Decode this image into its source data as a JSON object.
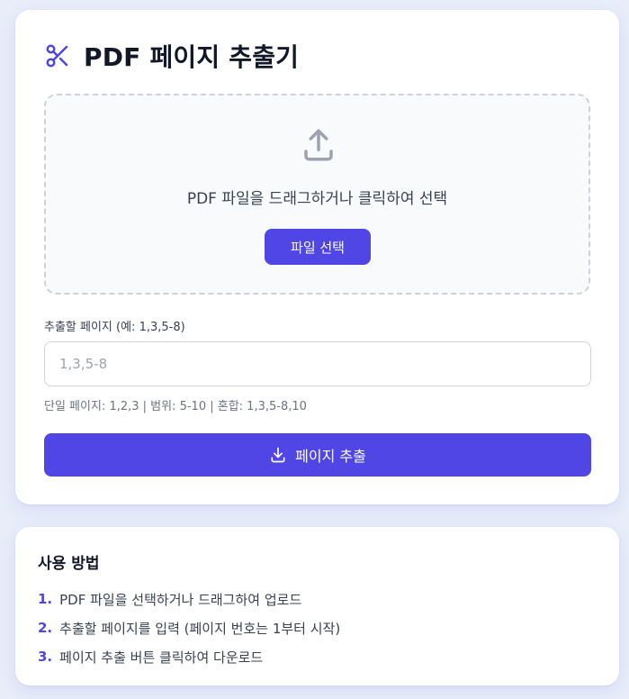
{
  "header": {
    "title": "PDF 페이지 추출기",
    "icon": "scissors-icon",
    "accent_color": "#4f46e5"
  },
  "dropzone": {
    "icon": "upload-icon",
    "text": "PDF 파일을 드래그하거나 클릭하여 선택",
    "button_label": "파일 선택"
  },
  "pages_field": {
    "label": "추출할 페이지 (예: 1,3,5-8)",
    "placeholder": "1,3,5-8",
    "value": "",
    "hint": "단일 페이지: 1,2,3 | 범위: 5-10 | 혼합: 1,3,5-8,10"
  },
  "extract_button": {
    "label": "페이지 추출",
    "icon": "download-icon"
  },
  "help": {
    "title": "사용 방법",
    "steps": [
      {
        "num": "1.",
        "text": "PDF 파일을 선택하거나 드래그하여 업로드"
      },
      {
        "num": "2.",
        "text": "추출할 페이지를 입력 (페이지 번호는 1부터 시작)"
      },
      {
        "num": "3.",
        "text": "페이지 추출 버튼 클릭하여 다운로드"
      }
    ]
  }
}
